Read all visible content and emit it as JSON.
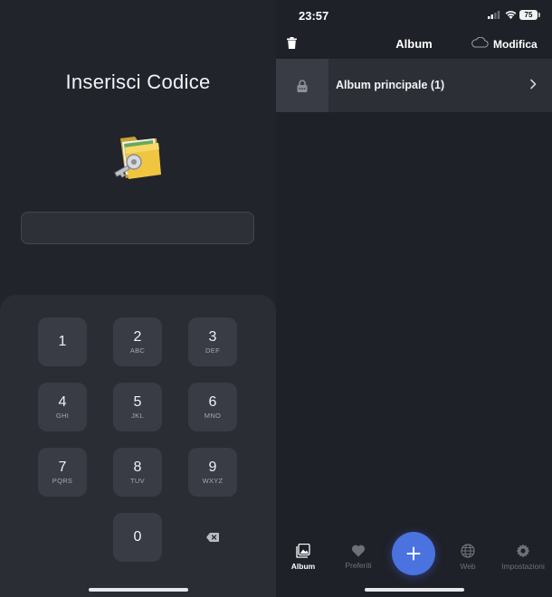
{
  "lock_screen": {
    "title": "Inserisci Codice",
    "code_value": "",
    "keys": [
      {
        "num": "1",
        "letters": ""
      },
      {
        "num": "2",
        "letters": "ABC"
      },
      {
        "num": "3",
        "letters": "DEF"
      },
      {
        "num": "4",
        "letters": "GHI"
      },
      {
        "num": "5",
        "letters": "JKL"
      },
      {
        "num": "6",
        "letters": "MNO"
      },
      {
        "num": "7",
        "letters": "PQRS"
      },
      {
        "num": "8",
        "letters": "TUV"
      },
      {
        "num": "9",
        "letters": "WXYZ"
      },
      {
        "num": "0",
        "letters": ""
      }
    ],
    "backspace_icon": "backspace-icon"
  },
  "albums_screen": {
    "status": {
      "time": "23:57",
      "battery": "75"
    },
    "nav": {
      "title": "Album",
      "edit_label": "Modifica"
    },
    "albums": [
      {
        "label": "Album principale (1)",
        "locked": true
      }
    ],
    "tabs": [
      {
        "label": "Album",
        "icon": "album-icon",
        "active": true
      },
      {
        "label": "Preferiti",
        "icon": "heart-icon",
        "active": false
      },
      {
        "label": "Web",
        "icon": "globe-icon",
        "active": false
      },
      {
        "label": "Impostazioni",
        "icon": "gear-icon",
        "active": false
      }
    ],
    "fab_icon": "plus-icon"
  },
  "colors": {
    "background": "#22242c",
    "keypad": "#2b2d35",
    "key": "#3a3c45",
    "accent": "#4a73e0"
  }
}
